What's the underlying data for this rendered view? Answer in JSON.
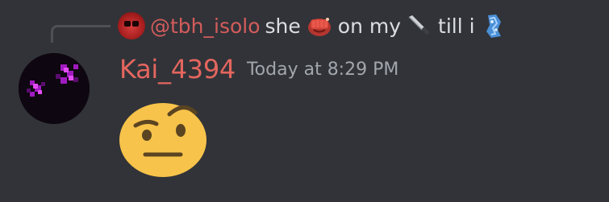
{
  "reply": {
    "mention": "@tbh_isolo",
    "words": [
      "she",
      "on my",
      "till i"
    ],
    "emoji_icons": [
      "punching-fist-emoji-icon",
      "knife-emoji-icon",
      "crystal-emoji-icon"
    ]
  },
  "message": {
    "author": "Kai_4394",
    "timestamp": "Today at 8:29 PM",
    "content_emoji": "face-with-raised-eyebrow-emoji-icon"
  },
  "colors": {
    "background": "#313338",
    "author_color": "#e4665f",
    "mention_color": "#d45c5c",
    "timestamp_color": "#a2a6ad",
    "text_color": "#dbdee1"
  }
}
